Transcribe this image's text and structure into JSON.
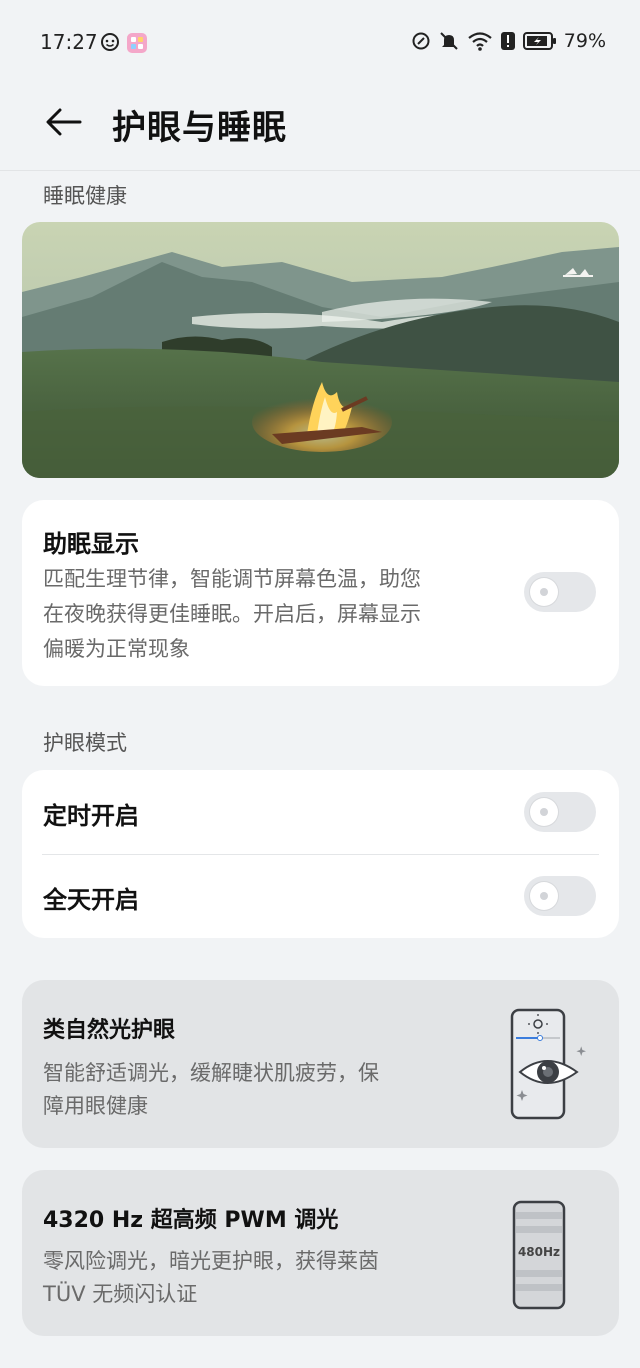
{
  "status_bar": {
    "time": "17:27",
    "battery_percent": "79%",
    "icons": [
      "face-icon",
      "app-notification-icon",
      "nfc-icon",
      "mute-bell-icon",
      "wifi-icon",
      "alert-icon",
      "battery-icon"
    ]
  },
  "header": {
    "title": "护眼与睡眠",
    "back_icon": "back-arrow-icon"
  },
  "sleep_section": {
    "title": "睡眠健康",
    "hero_image": "campfire-mountain-landscape",
    "sleep_display": {
      "title": "助眠显示",
      "description_lines": [
        "匹配生理节律，智能调节屏幕色温，助您",
        "在夜晚获得更佳睡眠。开启后，屏幕显示",
        "偏暖为正常现象"
      ],
      "enabled": false
    }
  },
  "eye_mode_section": {
    "title": "护眼模式",
    "items": [
      {
        "label": "定时开启",
        "enabled": false
      },
      {
        "label": "全天开启",
        "enabled": false
      }
    ]
  },
  "features": [
    {
      "title": "类自然光护眼",
      "description_lines": [
        "智能舒适调光，缓解睫状肌疲劳，保",
        "障用眼健康"
      ],
      "illustration": "eye-phone-icon"
    },
    {
      "title": "4320 Hz 超高频 PWM 调光",
      "description_lines": [
        "零风险调光，暗光更护眼，获得莱茵",
        "TÜV 无频闪认证"
      ],
      "illustration": "pwm-phone-icon",
      "illustration_label": "480Hz"
    }
  ],
  "colors": {
    "background": "#f1f3f5",
    "card": "#ffffff",
    "feature_card": "#e2e4e6",
    "toggle_off": "#e5e7ea",
    "accent_blue": "#3b7ddd"
  }
}
